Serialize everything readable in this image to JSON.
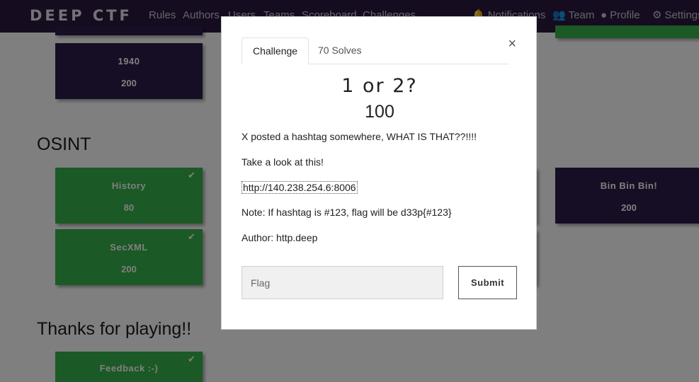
{
  "brand": "DEEP CTF",
  "nav": {
    "rules": "Rules",
    "authors": "Authors",
    "users": "Users",
    "teams": "Teams",
    "scoreboard": "Scoreboard",
    "challenges": "Challenges",
    "notifications": "Notifications",
    "team": "Team",
    "profile": "Profile",
    "settings": "Settings"
  },
  "sections": {
    "osint": "OSINT",
    "thanks": "Thanks for playing!!"
  },
  "cards": {
    "c1940": {
      "name": "1940",
      "value": "200"
    },
    "history": {
      "name": "History",
      "value": "80"
    },
    "secxml": {
      "name": "SecXML",
      "value": "200"
    },
    "binbinbin": {
      "name": "Bin Bin Bin!",
      "value": "200"
    },
    "feedback": {
      "name": "Feedback :-)"
    }
  },
  "modal": {
    "tab_challenge": "Challenge",
    "tab_solves": "70 Solves",
    "close": "×",
    "name": "1 or 2?",
    "value": "100",
    "description": [
      "X posted a hashtag somewhere, WHAT IS THAT??!!!!",
      "Take a look at this!",
      "http://140.238.254.6:8006",
      "Note: If hashtag is #123, flag will be d33p{#123}",
      "Author: http.deep"
    ],
    "flag_placeholder": "Flag",
    "submit": "Submit"
  },
  "colors": {
    "navbar": "#2a1a3e",
    "card_unsolved": "#2d1d48",
    "card_solved": "#37b24d"
  }
}
